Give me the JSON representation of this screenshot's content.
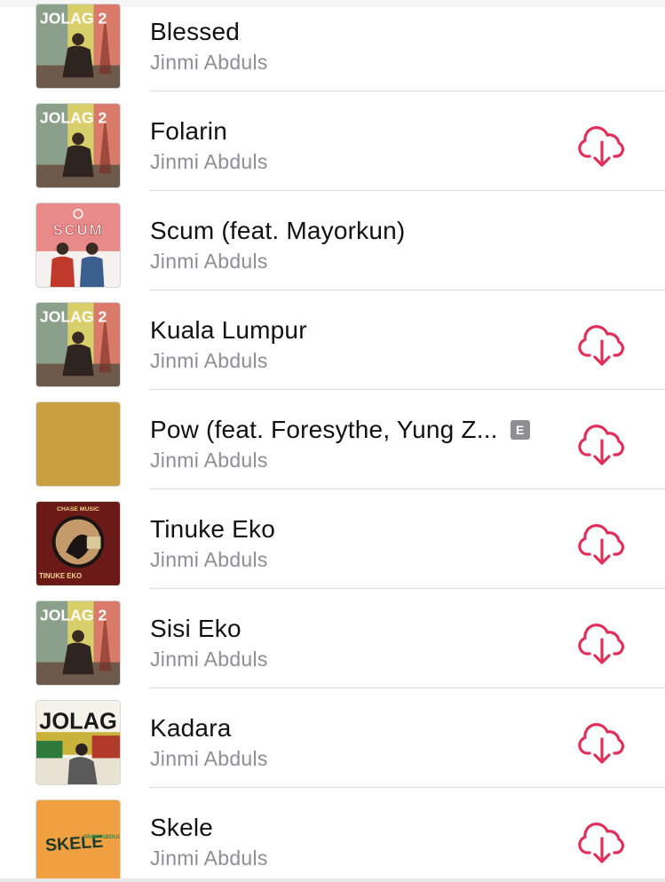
{
  "colors": {
    "accent": "#e0305a",
    "secondary_text": "#8e8e93",
    "explicit_badge": "#8e8e93"
  },
  "songs": [
    {
      "title": "Blessed",
      "artist": "Jinmi Abduls",
      "artwork": "jolag-2",
      "explicit": false,
      "downloadable": false,
      "artwork_text": "JOLAG 2"
    },
    {
      "title": "Folarin",
      "artist": "Jinmi Abduls",
      "artwork": "jolag-2",
      "explicit": false,
      "downloadable": true,
      "artwork_text": "JOLAG 2"
    },
    {
      "title": "Scum (feat. Mayorkun)",
      "artist": "Jinmi Abduls",
      "artwork": "scum",
      "explicit": false,
      "downloadable": false,
      "artwork_text": "SCUM"
    },
    {
      "title": "Kuala Lumpur",
      "artist": "Jinmi Abduls",
      "artwork": "jolag-2",
      "explicit": false,
      "downloadable": true,
      "artwork_text": "JOLAG 2"
    },
    {
      "title": "Pow (feat. Foresythe, Yung Z...",
      "artist": "Jinmi Abduls",
      "artwork": "gold-square",
      "explicit": true,
      "explicit_label": "E",
      "downloadable": true
    },
    {
      "title": "Tinuke Eko",
      "artist": "Jinmi Abduls",
      "artwork": "tinuke-eko",
      "explicit": false,
      "downloadable": true,
      "artwork_text": "TINUKE EKO",
      "artwork_subtext": "CHASE MUSIC"
    },
    {
      "title": "Sisi Eko",
      "artist": "Jinmi Abduls",
      "artwork": "jolag-2",
      "explicit": false,
      "downloadable": true,
      "artwork_text": "JOLAG 2"
    },
    {
      "title": "Kadara",
      "artist": "Jinmi Abduls",
      "artwork": "jolag",
      "explicit": false,
      "downloadable": true,
      "artwork_text": "JOLAG"
    },
    {
      "title": "Skele",
      "artist": "Jinmi Abduls",
      "artwork": "skele",
      "explicit": false,
      "downloadable": true,
      "artwork_text": "SKELE",
      "artwork_subtext": "JINMI ABDULS"
    }
  ],
  "icons": {
    "download": "cloud-download-icon"
  }
}
